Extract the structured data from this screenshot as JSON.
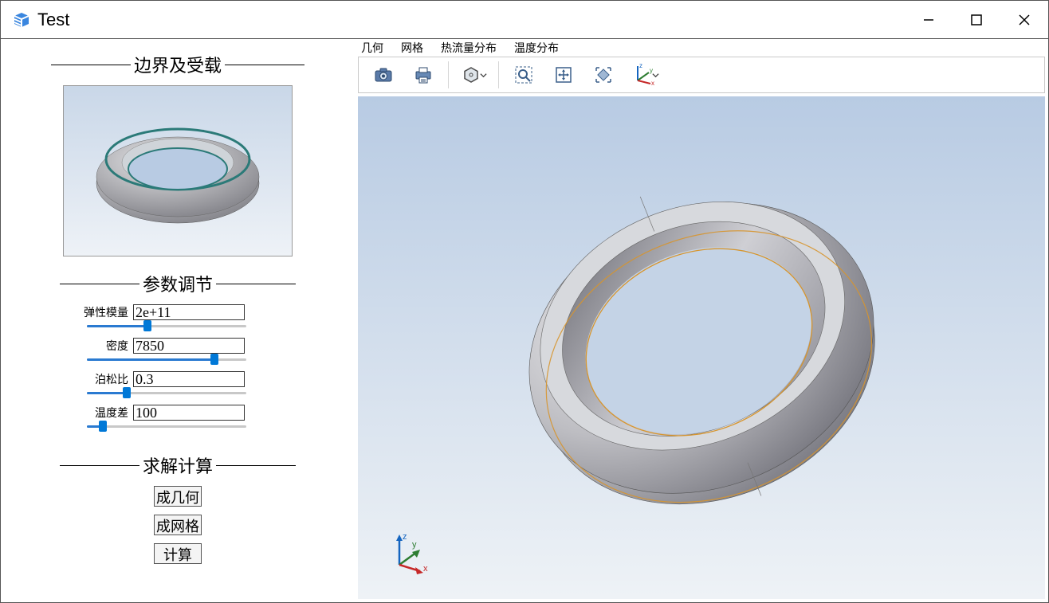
{
  "window": {
    "title": "Test",
    "minimize_label": "Minimize",
    "maximize_label": "Maximize",
    "close_label": "Close"
  },
  "sidebar": {
    "groups": {
      "boundary": {
        "title": "边界及受载"
      },
      "params": {
        "title": "参数调节"
      },
      "solve": {
        "title": "求解计算"
      }
    },
    "params": [
      {
        "label": "弹性模量",
        "value": "2e+11",
        "slider_pct": 38
      },
      {
        "label": "密度",
        "value": "7850",
        "slider_pct": 80
      },
      {
        "label": "泊松比",
        "value": "0.3",
        "slider_pct": 25
      },
      {
        "label": "温度差",
        "value": "100",
        "slider_pct": 10
      }
    ],
    "buttons": {
      "geometry": "成几何",
      "mesh": "成网格",
      "compute": "计算"
    }
  },
  "viewport": {
    "tabs": [
      "几何",
      "网格",
      "热流量分布",
      "温度分布"
    ],
    "toolbar": {
      "camera": "camera-icon",
      "print": "printer-icon",
      "render_mode": "hexagon-icon",
      "zoom_area": "zoom-area-icon",
      "pan": "pan-icon",
      "fit": "fit-icon",
      "axes": "axes-icon"
    },
    "axes": {
      "x": "x",
      "y": "y",
      "z": "z"
    }
  },
  "icons": {
    "app": "cube-app-icon"
  }
}
